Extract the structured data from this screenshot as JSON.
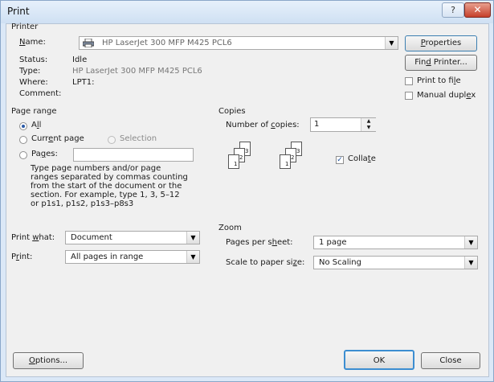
{
  "window": {
    "title": "Print",
    "help_glyph": "?",
    "close_glyph": "✕"
  },
  "printer": {
    "group_label": "Printer",
    "name_label": "Name:",
    "name_value": "HP LaserJet 300 MFP M425 PCL6",
    "status_label": "Status:",
    "status_value": "Idle",
    "type_label": "Type:",
    "type_value": "HP LaserJet 300 MFP M425 PCL6",
    "where_label": "Where:",
    "where_value": "LPT1:",
    "comment_label": "Comment:",
    "properties_button": "Properties",
    "find_printer_button": "Find Printer...",
    "print_to_file_label": "Print to file",
    "manual_duplex_label": "Manual duplex"
  },
  "page_range": {
    "group_label": "Page range",
    "all_label": "All",
    "current_page_label": "Current page",
    "selection_label": "Selection",
    "pages_label": "Pages:",
    "pages_value": "",
    "help_lines": [
      "Type page numbers and/or page",
      "ranges separated by commas counting",
      "from the start of the document or the",
      "section. For example, type 1, 3, 5–12",
      "or p1s1, p1s2, p1s3–p8s3"
    ]
  },
  "copies": {
    "group_label": "Copies",
    "number_label": "Number of copies:",
    "number_value": "1",
    "collate_label": "Collate",
    "collate_checked": true,
    "page_numbers": [
      "1",
      "2",
      "3"
    ]
  },
  "print_what": {
    "label": "Print what:",
    "value": "Document"
  },
  "print": {
    "label": "Print:",
    "value": "All pages in range"
  },
  "zoom": {
    "group_label": "Zoom",
    "pages_per_sheet_label": "Pages per sheet:",
    "pages_per_sheet_value": "1 page",
    "scale_label": "Scale to paper size:",
    "scale_value": "No Scaling"
  },
  "footer": {
    "options_button": "Options...",
    "ok_button": "OK",
    "close_button": "Close"
  },
  "icons": {
    "printer": "printer-icon",
    "dropdown": "▼",
    "spin_up": "▲",
    "spin_down": "▼",
    "checkmark": "✓"
  }
}
